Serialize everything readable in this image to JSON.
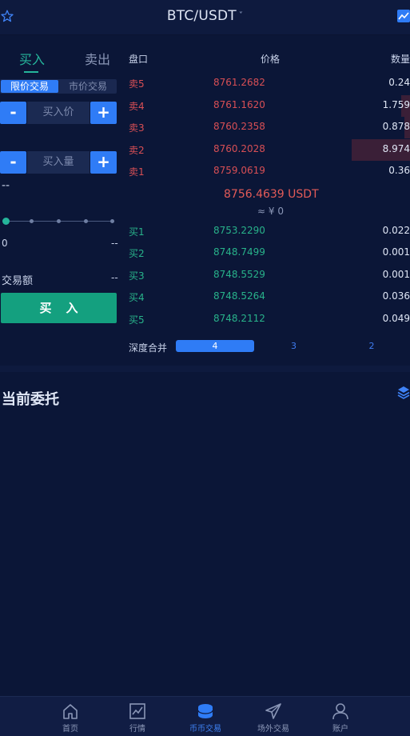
{
  "header": {
    "pair": "BTC/USDT",
    "caret": "˅"
  },
  "trade": {
    "tab_buy": "买入",
    "tab_sell": "卖出",
    "order_type_limit": "限价交易",
    "order_type_market": "市价交易",
    "price_placeholder": "买入价",
    "qty_placeholder": "买入量",
    "minus_label": "-",
    "plus_label": "+",
    "qty_unit_dash": "--",
    "slider_level": 0,
    "slider_min": "0",
    "slider_max": "--",
    "amount_label": "交易额",
    "amount_value": "--",
    "buy_button": "买入"
  },
  "orderbook": {
    "col_label": "盘口",
    "col_price": "价格",
    "col_qty": "数量",
    "asks": [
      {
        "label": "卖5",
        "price": "8761.2682",
        "qty": "0.24",
        "depth_fraction": 0
      },
      {
        "label": "卖4",
        "price": "8761.1620",
        "qty": "1.759",
        "depth_fraction": 0.03
      },
      {
        "label": "卖3",
        "price": "8760.2358",
        "qty": "0.878",
        "depth_fraction": 0.02
      },
      {
        "label": "卖2",
        "price": "8760.2028",
        "qty": "8.974",
        "depth_fraction": 0.2
      },
      {
        "label": "卖1",
        "price": "8759.0619",
        "qty": "0.36",
        "depth_fraction": 0
      }
    ],
    "last_price": "8756.4639 USDT",
    "last_price_cny": "≈ ¥ 0",
    "bids": [
      {
        "label": "买1",
        "price": "8753.2290",
        "qty": "0.022",
        "depth_fraction": 0
      },
      {
        "label": "买2",
        "price": "8748.7499",
        "qty": "0.001",
        "depth_fraction": 0
      },
      {
        "label": "买3",
        "price": "8748.5529",
        "qty": "0.001",
        "depth_fraction": 0
      },
      {
        "label": "买4",
        "price": "8748.5264",
        "qty": "0.036",
        "depth_fraction": 0
      },
      {
        "label": "买5",
        "price": "8748.2112",
        "qty": "0.049",
        "depth_fraction": 0
      }
    ],
    "depth_merge_label": "深度合并",
    "depth_options": [
      "4",
      "3",
      "2"
    ],
    "depth_selected": "4"
  },
  "orders": {
    "title": "当前委托"
  },
  "nav": {
    "items": [
      {
        "label": "首页",
        "icon": "home-icon"
      },
      {
        "label": "行情",
        "icon": "chart-icon"
      },
      {
        "label": "币币交易",
        "icon": "coins-icon"
      },
      {
        "label": "场外交易",
        "icon": "paper-plane-icon"
      },
      {
        "label": "账户",
        "icon": "user-icon"
      }
    ],
    "active": "币币交易"
  },
  "colors": {
    "background": "#0b1637",
    "accent_blue": "#2f7cf6",
    "buy_green": "#14a07f",
    "ask_red": "#d84f55",
    "bid_green": "#28b28a"
  }
}
